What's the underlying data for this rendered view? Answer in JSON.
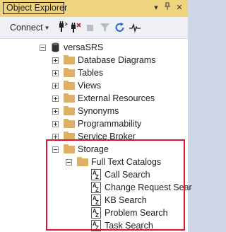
{
  "panel": {
    "title": "Object Explorer",
    "title_buttons": [
      "▾",
      "╤",
      "✕"
    ]
  },
  "toolbar": {
    "connect_label": "Connect",
    "tools": [
      "connect-server-icon",
      "disconnect-icon",
      "stop-icon",
      "filter-icon",
      "refresh-icon",
      "activity-monitor-icon"
    ]
  },
  "tree": {
    "server": "versaSRS",
    "folders": [
      "Database Diagrams",
      "Tables",
      "Views",
      "External Resources",
      "Synonyms",
      "Programmability",
      "Service Broker"
    ],
    "storage": {
      "label": "Storage",
      "full_text_catalogs": {
        "label": "Full Text Catalogs",
        "items": [
          "Call Search",
          "Change Request Sear",
          "KB Search",
          "Problem Search",
          "Task Search"
        ]
      }
    }
  },
  "colors": {
    "title_bar": "#f0d37d",
    "highlight_border": "#e0142e",
    "folder": "#dcb067"
  }
}
